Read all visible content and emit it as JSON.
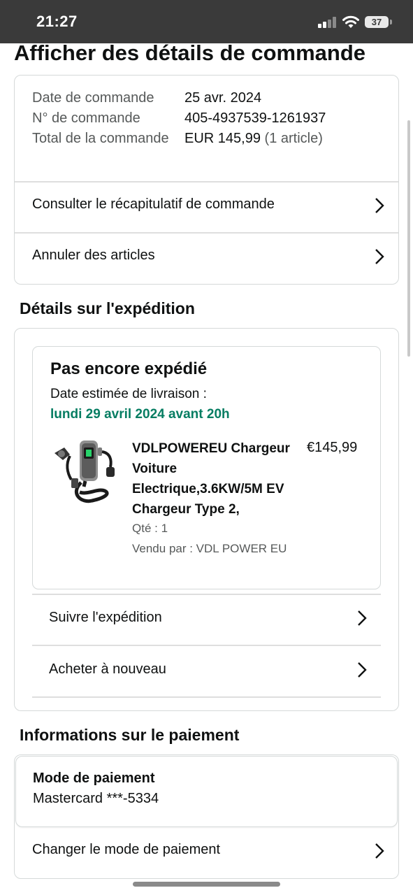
{
  "status_bar": {
    "time": "21:27",
    "battery": "37"
  },
  "page_title": "Afficher des détails de commande",
  "order_summary": {
    "date_label": "Date de commande",
    "date_value": "25 avr. 2024",
    "number_label": "N° de commande",
    "number_value": "405-4937539-1261937",
    "total_label": "Total de la commande",
    "total_value": "EUR 145,99",
    "total_count": "(1 article)",
    "view_summary_label": "Consulter le récapitulatif de commande",
    "cancel_items_label": "Annuler des articles"
  },
  "shipping": {
    "section_title": "Détails sur l'expédition",
    "status": "Pas encore expédié",
    "estimate_label": "Date estimée de livraison :",
    "estimate_date": "lundi 29 avril 2024 avant 20h",
    "product": {
      "title": "VDLPOWEREU Chargeur Voiture Electrique,3.6KW/5M EV Chargeur Type 2,",
      "price": "€145,99",
      "quantity": "Qté : 1",
      "seller": "Vendu par : VDL POWER EU"
    },
    "track_label": "Suivre l'expédition",
    "buy_again_label": "Acheter à nouveau"
  },
  "payment": {
    "section_title": "Informations sur le paiement",
    "method_label": "Mode de paiement",
    "method_value": "Mastercard  ***-5334",
    "change_label": "Changer le mode de paiement"
  },
  "colors": {
    "green": "#067d62",
    "border": "#d5d9d9",
    "status_bar": "#3a3a3a"
  },
  "icons": {
    "chevron": "chevron-right-icon",
    "wifi": "wifi-icon",
    "signal": "signal-icon",
    "battery": "battery-icon"
  }
}
